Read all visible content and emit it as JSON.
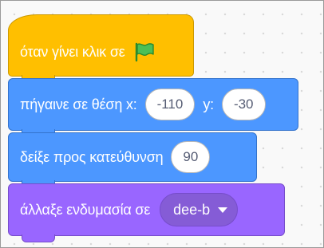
{
  "workspace": {
    "background": "#f9f9f9"
  },
  "blocks": {
    "when_flag_clicked": {
      "label": "όταν γίνει κλικ σε",
      "color": "#ffbf00",
      "icon": "green-flag-icon"
    },
    "go_to_xy": {
      "label": "πήγαινε σε θέση x:",
      "x_value": "-110",
      "y_label": "y:",
      "y_value": "-30",
      "color": "#4c97ff"
    },
    "point_in_direction": {
      "label": "δείξε προς κατεύθυνση",
      "direction_value": "90",
      "color": "#4c97ff"
    },
    "switch_costume": {
      "label": "άλλαξε ενδυμασία σε",
      "costume_value": "dee-b",
      "color": "#9966ff"
    }
  }
}
